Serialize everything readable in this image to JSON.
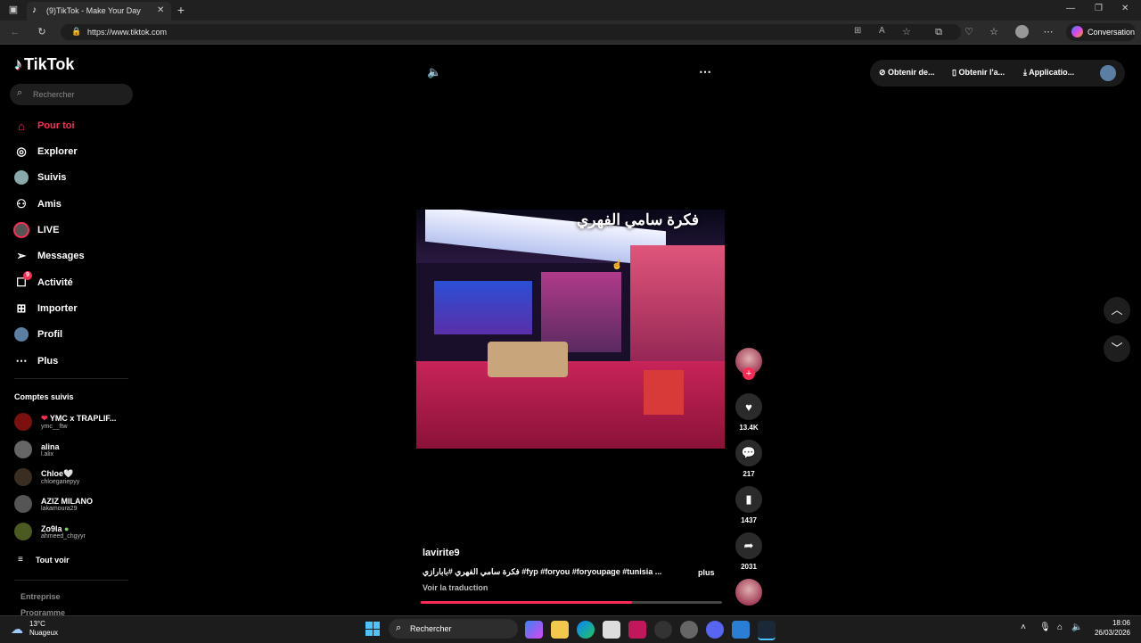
{
  "browser": {
    "tab_title": "(9)TikTok - Make Your Day",
    "url": "https://www.tiktok.com",
    "conversation_label": "Conversation"
  },
  "tiktok": {
    "logo": "TikTok",
    "search_placeholder": "Rechercher",
    "nav": [
      {
        "label": "Pour toi",
        "icon": "home-icon"
      },
      {
        "label": "Explorer",
        "icon": "compass-icon"
      },
      {
        "label": "Suivis",
        "icon": "following-icon"
      },
      {
        "label": "Amis",
        "icon": "friends-icon"
      },
      {
        "label": "LIVE",
        "icon": "live-icon"
      },
      {
        "label": "Messages",
        "icon": "paper-plane-icon"
      },
      {
        "label": "Activité",
        "icon": "activity-icon",
        "badge": "9"
      },
      {
        "label": "Importer",
        "icon": "plus-square-icon"
      },
      {
        "label": "Profil",
        "icon": "profile-icon"
      },
      {
        "label": "Plus",
        "icon": "more-icon"
      }
    ],
    "followed_header": "Comptes suivis",
    "followed": [
      {
        "name": "YMC x TRAPLIF...",
        "user": "ymc__ftw"
      },
      {
        "name": "alina",
        "user": "l.alix"
      },
      {
        "name": "Chloe🤍",
        "user": "chloegariepyy"
      },
      {
        "name": "AZIZ MILANO",
        "user": "lakamoura29"
      },
      {
        "name": "Zo9la",
        "user": "ahmeed_chgyyr"
      }
    ],
    "see_all": "Tout voir",
    "footer_1": "Entreprise",
    "footer_2": "Programme",
    "top_right": {
      "btn1": "Obtenir de...",
      "btn2": "Obtenir l'a...",
      "btn3": "Applicatio..."
    },
    "video": {
      "author": "lavirite9",
      "caption": "فكرة سامي الفهري #بابارازي #fyp #foryou #foryoupage #tunisia ...",
      "more": "plus",
      "translate": "Voir la traduction",
      "progress": 0.7,
      "overlay_text": "فكرة سامي الفهري"
    },
    "actions": {
      "likes": "13.4K",
      "comments": "217",
      "saves": "1437",
      "shares": "2031"
    }
  },
  "taskbar": {
    "weather_temp": "13°C",
    "weather_desc": "Nuageux",
    "search": "Rechercher",
    "time": "18:06",
    "date": "26/03/2026"
  },
  "colors": {
    "accent": "#fe2c55",
    "bg": "#000000"
  }
}
